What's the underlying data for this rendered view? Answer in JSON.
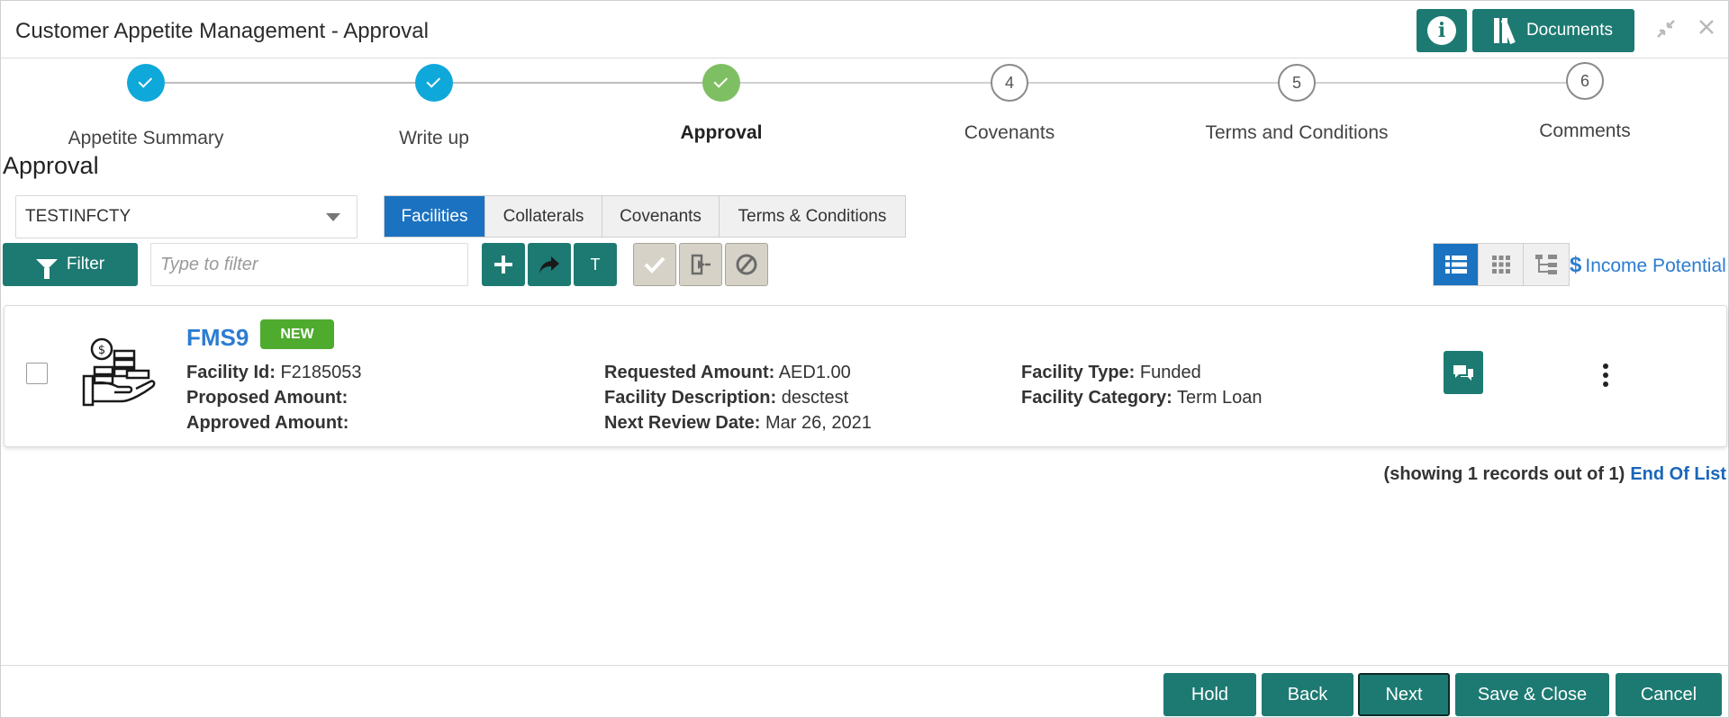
{
  "header": {
    "title": "Customer Appetite Management - Approval",
    "info_icon": "i",
    "documents_label": "Documents"
  },
  "stepper": {
    "steps": [
      {
        "label": "Appetite Summary",
        "state": "done",
        "number": ""
      },
      {
        "label": "Write up",
        "state": "done",
        "number": ""
      },
      {
        "label": "Approval",
        "state": "current",
        "number": ""
      },
      {
        "label": "Covenants",
        "state": "todo",
        "number": "4"
      },
      {
        "label": "Terms and Conditions",
        "state": "todo",
        "number": "5"
      },
      {
        "label": "Comments",
        "state": "todo",
        "number": "6"
      }
    ]
  },
  "section_title": "Approval",
  "customer_select": {
    "value": "TESTINFCTY"
  },
  "tabs": [
    {
      "label": "Facilities",
      "active": true
    },
    {
      "label": "Collaterals",
      "active": false
    },
    {
      "label": "Covenants",
      "active": false
    },
    {
      "label": "Terms & Conditions",
      "active": false
    }
  ],
  "toolbar": {
    "filter_label": "Filter",
    "filter_placeholder": "Type to filter",
    "add_icon": "+",
    "t_label": "T",
    "income_potential_label": "Income Potential",
    "income_currency_symbol": "$"
  },
  "facility": {
    "name": "FMS9",
    "status_badge": "NEW",
    "facility_id_label": "Facility Id:",
    "facility_id": "F2185053",
    "proposed_amount_label": "Proposed Amount:",
    "proposed_amount": "",
    "approved_amount_label": "Approved Amount:",
    "approved_amount": "",
    "requested_amount_label": "Requested Amount:",
    "requested_amount": "AED1.00",
    "facility_description_label": "Facility Description:",
    "facility_description": "desctest",
    "next_review_date_label": "Next Review Date:",
    "next_review_date": "Mar 26, 2021",
    "facility_type_label": "Facility Type:",
    "facility_type": "Funded",
    "facility_category_label": "Facility Category:",
    "facility_category": "Term Loan"
  },
  "records": {
    "text": "(showing 1 records out of 1)",
    "end_label": "End Of List"
  },
  "footer": {
    "hold": "Hold",
    "back": "Back",
    "next": "Next",
    "save_close": "Save & Close",
    "cancel": "Cancel"
  },
  "colors": {
    "primary_teal": "#1d7a72",
    "active_blue": "#1b72c0",
    "step_done": "#0fa8da",
    "step_current": "#7fbf63",
    "badge_green": "#4eab2e",
    "link_blue": "#2c7cd1"
  }
}
